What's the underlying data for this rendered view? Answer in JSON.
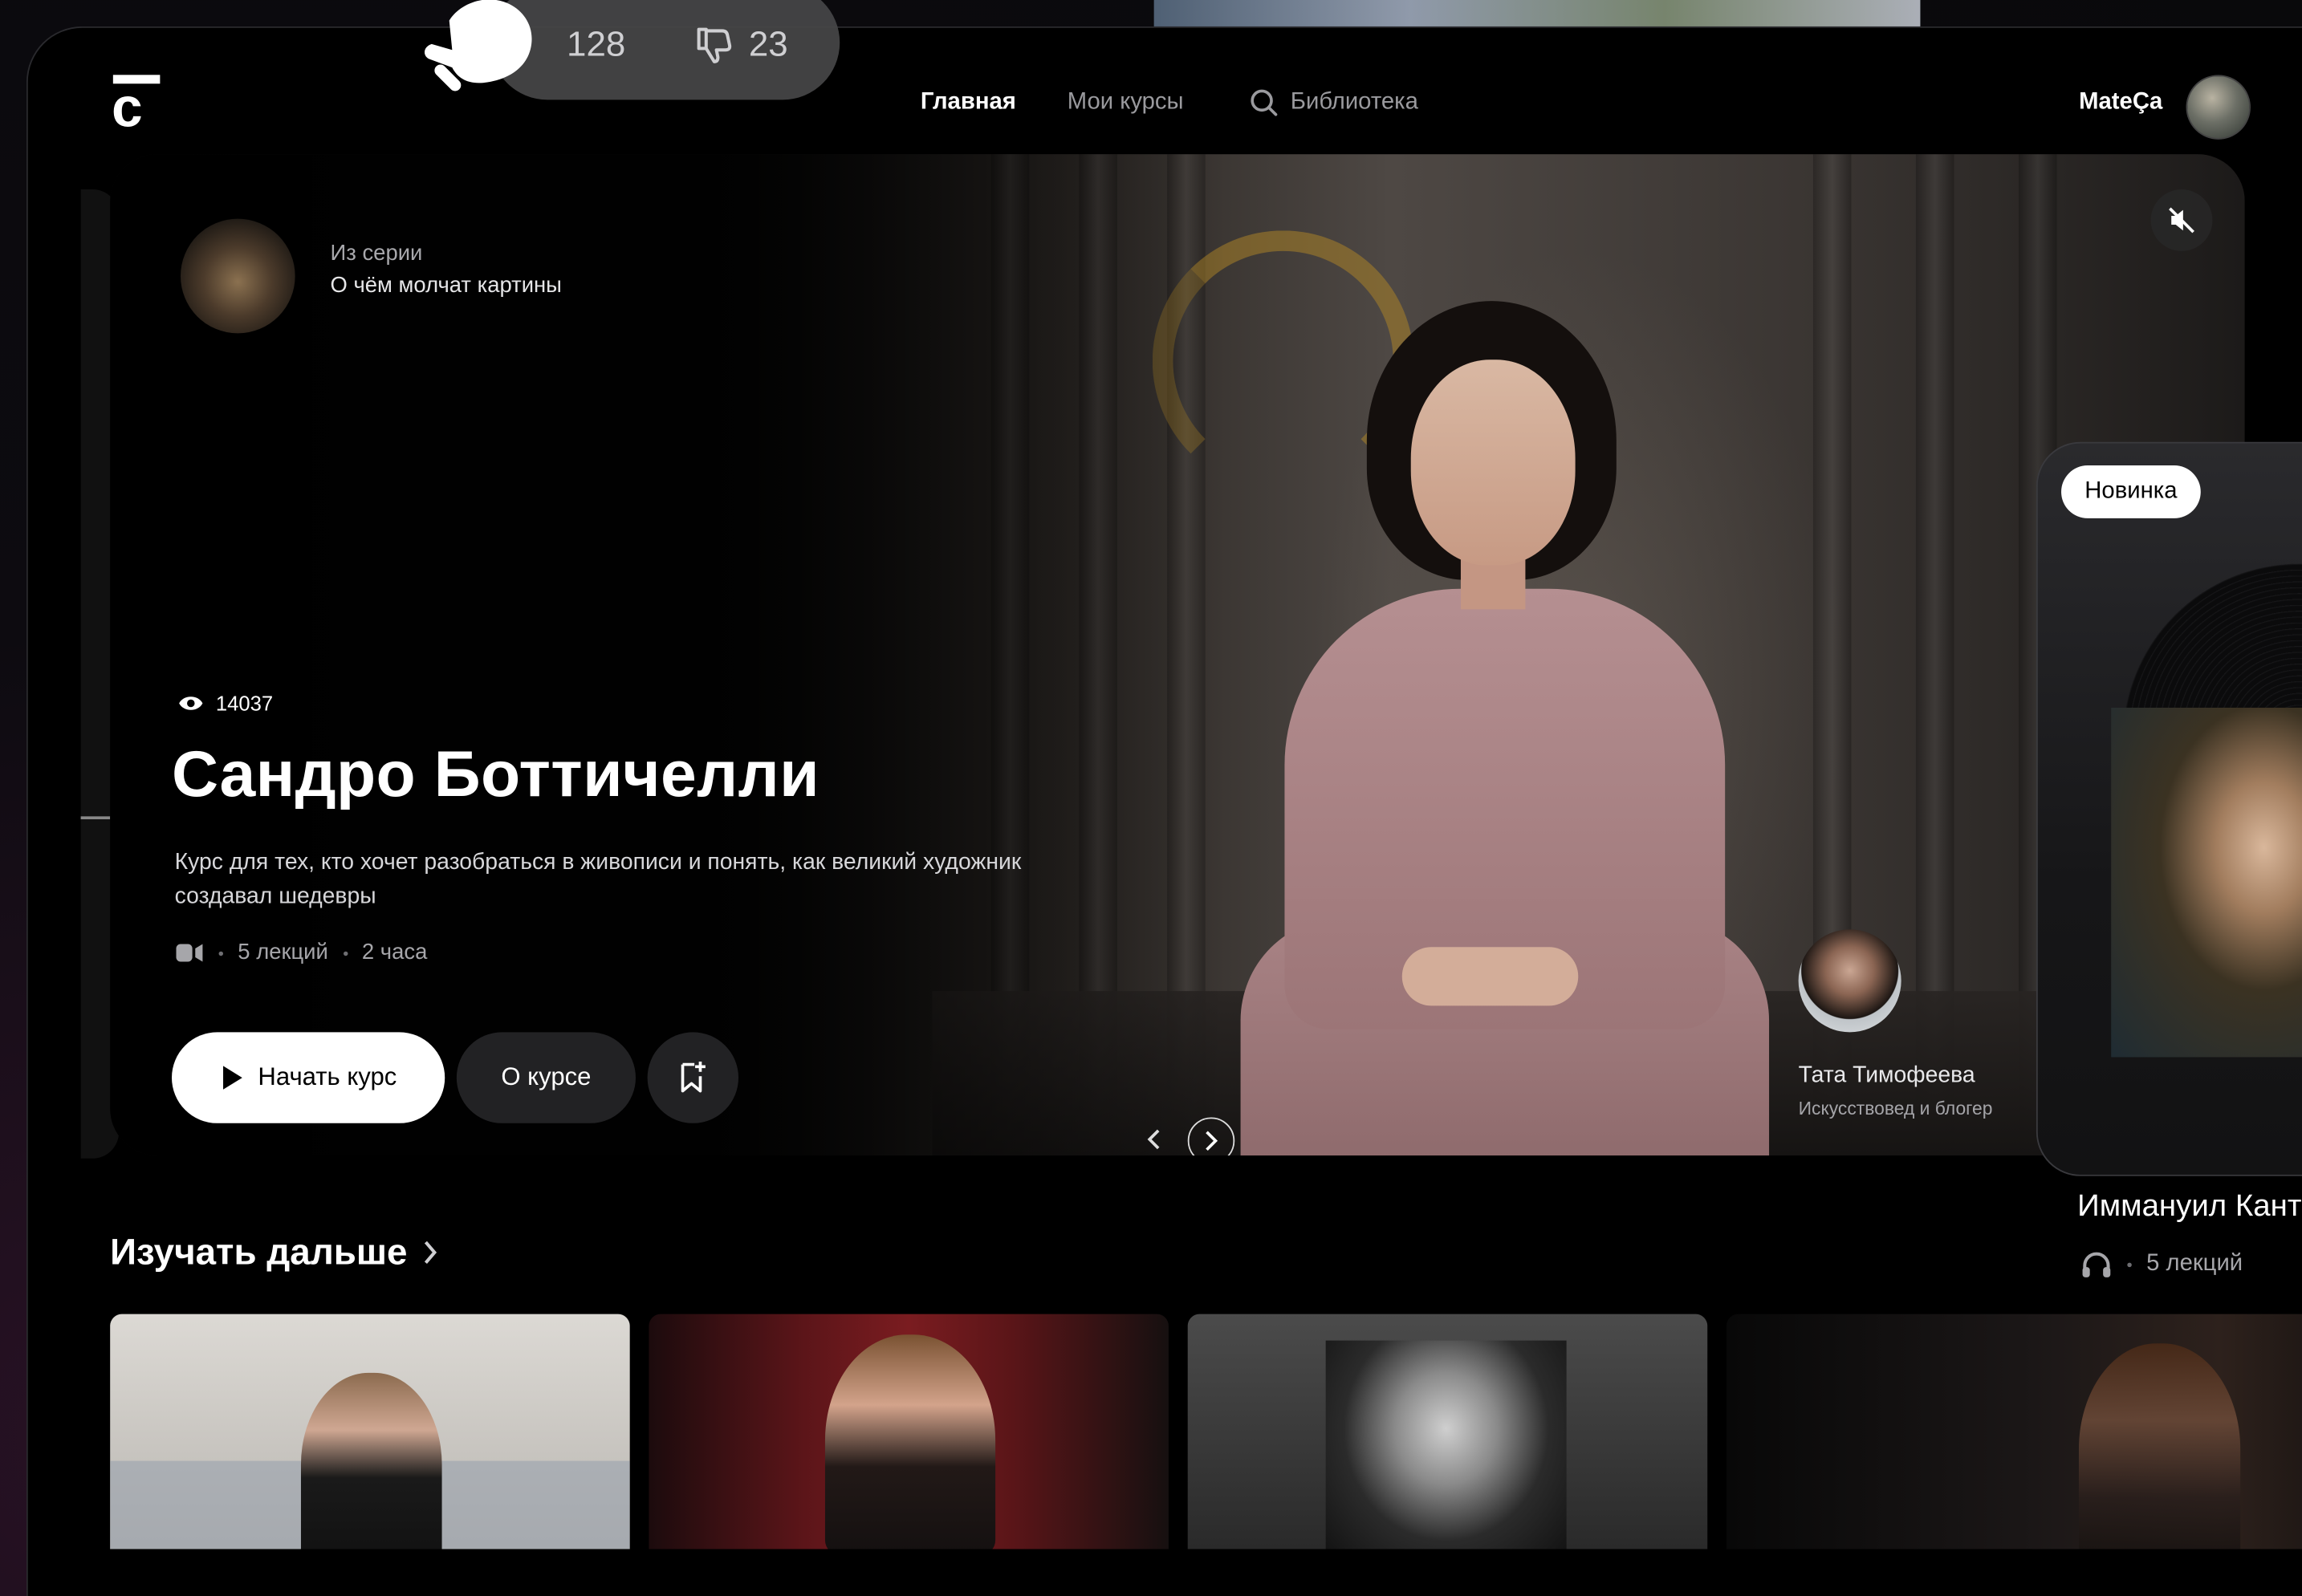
{
  "header": {
    "nav": {
      "home": "Главная",
      "my_courses": "Мои курсы",
      "library": "Библиотека"
    },
    "user": {
      "name": "MateÇa"
    }
  },
  "reactions": {
    "likes": "128",
    "dislikes": "23"
  },
  "hero": {
    "series_label": "Из серии",
    "series_title": "О чём молчат картины",
    "views": "14037",
    "title": "Сандро Боттичелли",
    "description": "Курс для тех, кто хочет разобраться в живописи и понять, как великий художник создавал шедевры",
    "lectures": "5 лекций",
    "duration": "2 часа",
    "start_button": "Начать курс",
    "about_button": "О курсе",
    "author": {
      "name": "Тата Тимофеева",
      "role": "Искусствовед и блогер"
    }
  },
  "side_card": {
    "badge": "Новинка",
    "title": "Иммануил Кант",
    "lectures": "5 лекций"
  },
  "section": {
    "title": "Изучать дальше"
  },
  "icons": {
    "logo": "logo-mark",
    "search": "search-icon",
    "eye": "eye-icon",
    "video": "video-icon",
    "play": "play-icon",
    "bookmark": "bookmark-plus-icon",
    "mute": "mute-icon",
    "headphones": "headphones-icon",
    "like": "thumbs-up-icon",
    "dislike": "thumbs-down-icon"
  },
  "colors": {
    "background": "#000000",
    "primary_button": "#ffffff",
    "secondary_button": "#222224",
    "muted_text": "#a6a6aa"
  }
}
